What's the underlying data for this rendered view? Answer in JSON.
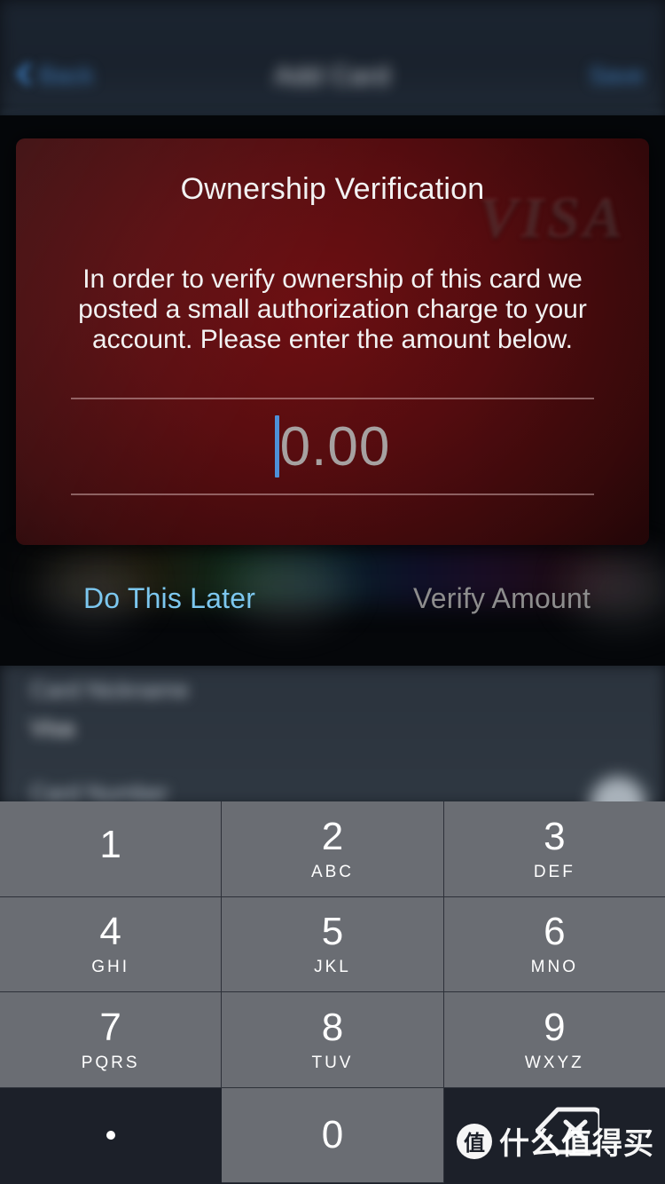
{
  "navbar": {
    "back_label": "Back",
    "title": "Add Card",
    "right_label": "Save",
    "back_icon": "chevron-left-icon"
  },
  "background_form": {
    "label_1": "Card Nickname",
    "value_1": "Visa",
    "label_2": "Card Number",
    "avatar_icon": "avatar-icon"
  },
  "modal": {
    "brand_logo": "VISA",
    "title": "Ownership Verification",
    "body": "In order to verify ownership of this card we posted a small authorization charge to your account. Please enter the amount below.",
    "amount_placeholder": "0.00",
    "amount_value": "",
    "caret_color": "#4d90d8",
    "card_color": "#5a0d10"
  },
  "actions": {
    "later_label": "Do This Later",
    "later_color": "#7cc7ef",
    "verify_label": "Verify Amount",
    "verify_color": "#8d8d8d",
    "verify_enabled": false
  },
  "keypad": {
    "rows": [
      [
        {
          "digit": "1",
          "letters": ""
        },
        {
          "digit": "2",
          "letters": "ABC"
        },
        {
          "digit": "3",
          "letters": "DEF"
        }
      ],
      [
        {
          "digit": "4",
          "letters": "GHI"
        },
        {
          "digit": "5",
          "letters": "JKL"
        },
        {
          "digit": "6",
          "letters": "MNO"
        }
      ],
      [
        {
          "digit": "7",
          "letters": "PQRS"
        },
        {
          "digit": "8",
          "letters": "TUV"
        },
        {
          "digit": "9",
          "letters": "WXYZ"
        }
      ]
    ],
    "bottom": {
      "decimal": ".",
      "zero": "0",
      "delete_icon": "backspace-delete-icon"
    },
    "key_color": "#6a6d73",
    "dark_key_color": "#1c2029"
  },
  "watermark": {
    "badge": "值",
    "text": "什么值得买"
  }
}
